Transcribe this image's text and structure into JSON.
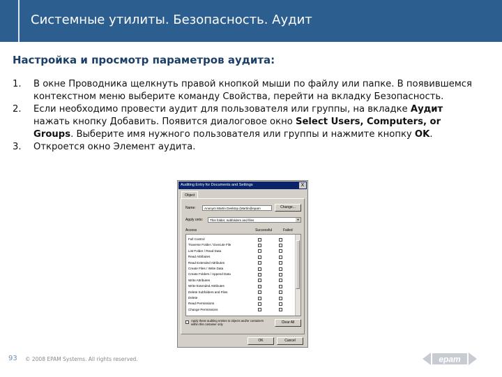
{
  "header": {
    "title": "Системные утилиты. Безопасность. Аудит"
  },
  "subtitle": "Настройка и просмотр параметров аудита:",
  "steps": [
    {
      "num": "1.",
      "parts": [
        {
          "text": "В окне Проводника щелкнуть правой кнопкой мыши по файлу или папке. В появившемся контекстном меню выберите команду Свойства, перейти на вкладку Безопасность.",
          "bold": false
        }
      ]
    },
    {
      "num": "2.",
      "parts": [
        {
          "text": "Если необходимо провести аудит для пользователя или группы, на вкладке ",
          "bold": false
        },
        {
          "text": "Аудит",
          "bold": true
        },
        {
          "text": " нажать кнопку Добавить. Появится диалоговое окно ",
          "bold": false
        },
        {
          "text": "Select Users, Computers, or Groups",
          "bold": true
        },
        {
          "text": ". Выберите имя нужного пользователя или группы и нажмите кнопку ",
          "bold": false
        },
        {
          "text": "OK",
          "bold": true
        },
        {
          "text": ".",
          "bold": false
        }
      ]
    },
    {
      "num": "3.",
      "parts": [
        {
          "text": "Откроется окно Элемент аудита.",
          "bold": false
        }
      ]
    }
  ],
  "dialog": {
    "title": "Auditing Entry for Documents and Settings",
    "close_label": "X",
    "tab": "Object",
    "name_label": "Name:",
    "name_value": "Anonym Martin Desktop (Martin@epam",
    "change_button": "Change...",
    "apply_label": "Apply onto:",
    "apply_value": "This folder, subfolders and files",
    "col_access": "Access",
    "col_successful": "Successful",
    "col_failed": "Failed",
    "rows": [
      "Full Control",
      "Traverse Folder / Execute File",
      "List Folder / Read Data",
      "Read Attributes",
      "Read Extended Attributes",
      "Create Files / Write Data",
      "Create Folders / Append Data",
      "Write Attributes",
      "Write Extended Attributes",
      "Delete Subfolders and Files",
      "Delete",
      "Read Permissions",
      "Change Permissions"
    ],
    "apply_check_text": "Apply these auditing entries to objects and/or containers within this container only",
    "clear_all_button": "Clear All",
    "ok_button": "OK",
    "cancel_button": "Cancel"
  },
  "footer": {
    "page_number": "93",
    "copyright": "© 2008 EPAM Systems. All rights reserved.",
    "logo_text": "epam"
  },
  "colors": {
    "header_bg": "#2c5f8f",
    "subtitle": "#1b3f66",
    "dialog_title_bg": "#0a246a"
  }
}
